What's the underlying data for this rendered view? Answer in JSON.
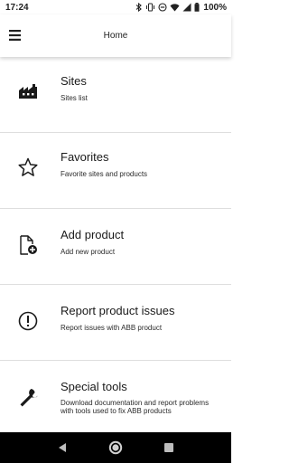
{
  "status_bar": {
    "time": "17:24",
    "battery": "100%"
  },
  "app_bar": {
    "title": "Home"
  },
  "menu_items": [
    {
      "title": "Sites",
      "subtitle": "Sites list",
      "icon": "factory-icon"
    },
    {
      "title": "Favorites",
      "subtitle": "Favorite sites and products",
      "icon": "star-icon"
    },
    {
      "title": "Add product",
      "subtitle": "Add new product",
      "icon": "add-document-icon"
    },
    {
      "title": "Report product issues",
      "subtitle": "Report issues with ABB product",
      "icon": "alert-circle-icon"
    },
    {
      "title": "Special tools",
      "subtitle": "Download documentation and report problems with tools used to fix ABB products",
      "icon": "wrench-icon"
    }
  ],
  "colors": {
    "background": "#ffffff",
    "text": "#1a1a1a",
    "divider": "#dedede",
    "nav_bar": "#000000"
  }
}
